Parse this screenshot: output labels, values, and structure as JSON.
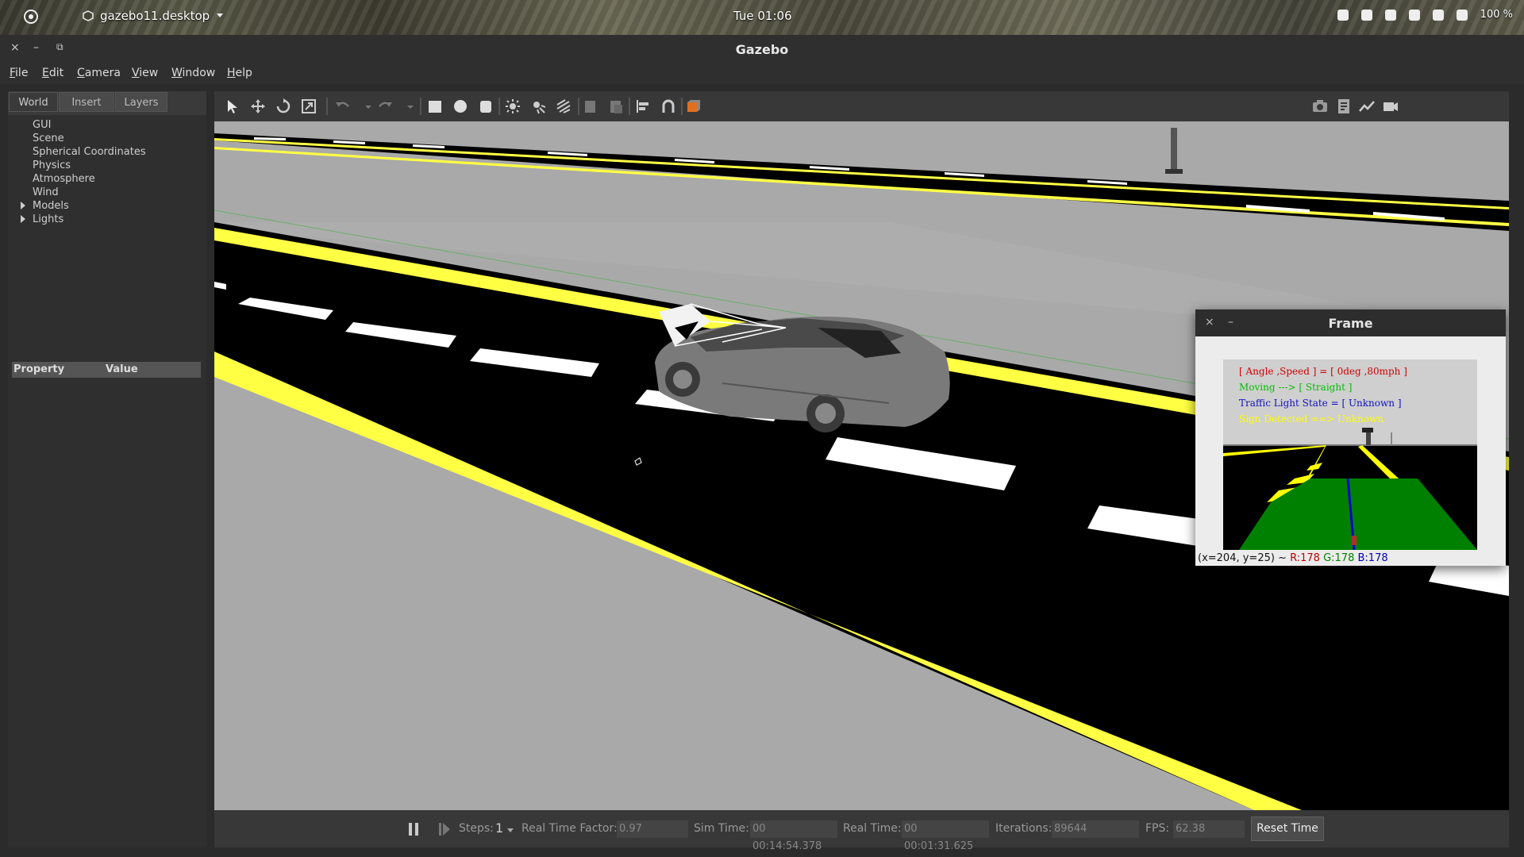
{
  "topbar": {
    "app_name": "gazebo11.desktop",
    "clock": "Tue 01:06",
    "battery": "100 %"
  },
  "window": {
    "title": "Gazebo",
    "close": "×",
    "minimize": "–",
    "restore": "⧉"
  },
  "menu": {
    "file": "File",
    "edit": "Edit",
    "camera": "Camera",
    "view": "View",
    "window": "Window",
    "help": "Help"
  },
  "left_panel": {
    "tabs": {
      "world": "World",
      "insert": "Insert",
      "layers": "Layers"
    },
    "tree": [
      "GUI",
      "Scene",
      "Spherical Coordinates",
      "Physics",
      "Atmosphere",
      "Wind",
      "Models",
      "Lights"
    ],
    "property_header": "Property",
    "value_header": "Value"
  },
  "frame_window": {
    "title": "Frame",
    "close": "×",
    "minimize": "–",
    "overlay": {
      "line1": "[ Angle ,Speed ] = [ 0deg ,80mph ]",
      "line2": "Moving ---> [ Straight ]",
      "line3": "Traffic Light State = [ Unknown ]",
      "line4": "Sign Detected ==> Unknown"
    },
    "pixel_coords": "(x=204, y=25) ~",
    "r": "R:178",
    "g": "G:178",
    "b": "B:178"
  },
  "bottom": {
    "steps_label": "Steps:",
    "steps_value": "1",
    "rtf_label": "Real Time Factor:",
    "rtf_value": "0.97",
    "sim_label": "Sim Time:",
    "sim_value": "00 00:14:54.378",
    "real_label": "Real Time:",
    "real_value": "00 00:01:31.625",
    "iter_label": "Iterations:",
    "iter_value": "89644",
    "fps_label": "FPS:",
    "fps_value": "62.38",
    "reset": "Reset Time"
  },
  "colors": {
    "road": "#000000",
    "lane_yellow": "#ffff44",
    "ground": "#a8a8a8",
    "overlay_red": "#d00000",
    "overlay_green": "#00c000",
    "overlay_blue": "#1010c0",
    "overlay_yellow": "#ffff00"
  }
}
